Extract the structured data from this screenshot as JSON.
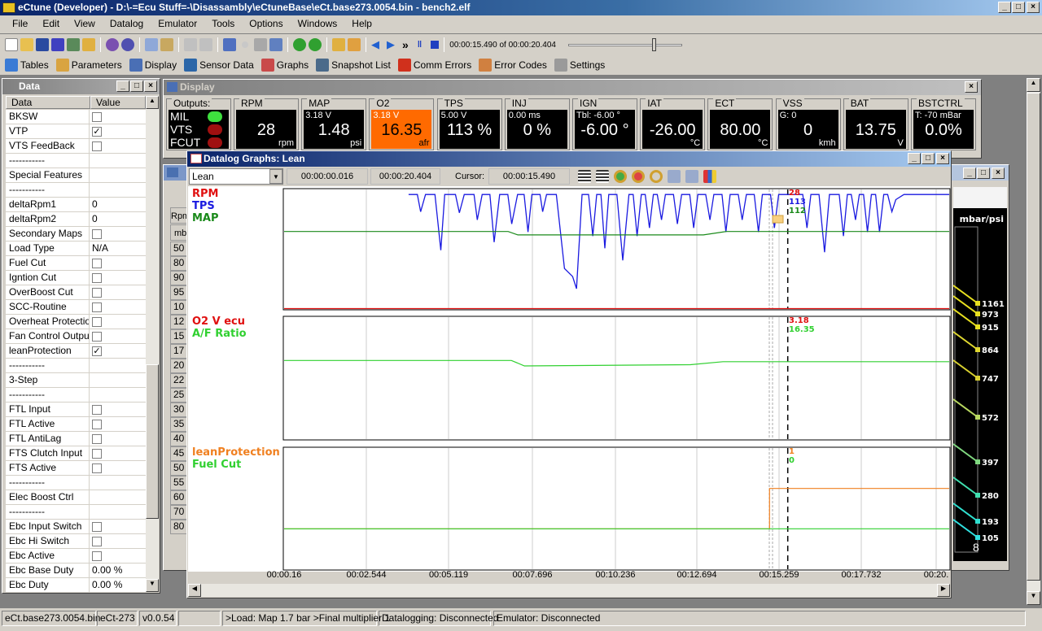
{
  "window": {
    "title": "eCtune (Developer) - D:\\-=Ecu Stuff=-\\Disassambly\\eCtuneBase\\eCt.base273.0054.bin - bench2.elf"
  },
  "menu": [
    "File",
    "Edit",
    "View",
    "Datalog",
    "Emulator",
    "Tools",
    "Options",
    "Windows",
    "Help"
  ],
  "toolbar": {
    "playback_time": "00:00:15.490 of 00:00:20.404",
    "playback_progress": 0.76
  },
  "toolbar2": [
    {
      "icon": "tables-icon",
      "label": "Tables",
      "color": "#3a7bd5"
    },
    {
      "icon": "parameters-icon",
      "label": "Parameters",
      "color": "#d9a441"
    },
    {
      "icon": "display-icon",
      "label": "Display",
      "color": "#4a6fb5"
    },
    {
      "icon": "sensor-data-icon",
      "label": "Sensor Data",
      "color": "#2b66a8"
    },
    {
      "icon": "graphs-icon",
      "label": "Graphs",
      "color": "#c94a4a"
    },
    {
      "icon": "snapshot-icon",
      "label": "Snapshot List",
      "color": "#4a6a8a"
    },
    {
      "icon": "comm-errors-icon",
      "label": "Comm Errors",
      "color": "#d0301c"
    },
    {
      "icon": "error-codes-icon",
      "label": "Error Codes",
      "color": "#d08040"
    },
    {
      "icon": "settings-icon",
      "label": "Settings",
      "color": "#9a9a9a"
    }
  ],
  "data_panel": {
    "title": "Data",
    "col_data": "Data",
    "col_value": "Value",
    "rows": [
      [
        "BKSW",
        "cb"
      ],
      [
        "VTP",
        "cbx"
      ],
      [
        "VTS FeedBack",
        "cb"
      ],
      [
        "-----------",
        ""
      ],
      [
        "Special Features",
        ""
      ],
      [
        "-----------",
        ""
      ],
      [
        "deltaRpm1",
        "0"
      ],
      [
        "deltaRpm2",
        "0"
      ],
      [
        "Secondary Maps",
        "cb"
      ],
      [
        "Load Type",
        "N/A"
      ],
      [
        "Fuel Cut",
        "cb"
      ],
      [
        "Igntion Cut",
        "cb"
      ],
      [
        "OverBoost Cut",
        "cb"
      ],
      [
        "SCC-Routine",
        "cb"
      ],
      [
        "Overheat Protection",
        "cb"
      ],
      [
        "Fan Control Output",
        "cb"
      ],
      [
        "leanProtection",
        "cbx"
      ],
      [
        "-----------",
        ""
      ],
      [
        "3-Step",
        ""
      ],
      [
        "-----------",
        ""
      ],
      [
        "FTL Input",
        "cb"
      ],
      [
        "FTL Active",
        "cb"
      ],
      [
        "FTL AntiLag",
        "cb"
      ],
      [
        "FTS Clutch Input",
        "cb"
      ],
      [
        "FTS Active",
        "cb"
      ],
      [
        "-----------",
        ""
      ],
      [
        "Elec Boost Ctrl",
        ""
      ],
      [
        "-----------",
        ""
      ],
      [
        "Ebc Input Switch",
        "cb"
      ],
      [
        "Ebc Hi Switch",
        "cb"
      ],
      [
        "Ebc Active",
        "cb"
      ],
      [
        "Ebc Base Duty",
        "0.00 %"
      ],
      [
        "Ebc Duty",
        "0.00 %"
      ]
    ]
  },
  "display": {
    "title": "Display",
    "outputs_label": "Outputs:",
    "outputs": [
      {
        "name": "MIL",
        "color": "#3ee03e"
      },
      {
        "name": "VTS",
        "color": "#a01010"
      },
      {
        "name": "FCUT",
        "color": "#a01010"
      }
    ],
    "gauges": [
      {
        "label": "RPM",
        "sub": "",
        "value": "28",
        "unit": "rpm"
      },
      {
        "label": "MAP",
        "sub": "3.18 V",
        "value": "1.48",
        "unit": "psi"
      },
      {
        "label": "O2",
        "sub": "3.18 V",
        "value": "16.35",
        "unit": "afr",
        "bg": "#ff6a00"
      },
      {
        "label": "TPS",
        "sub": "5.00 V",
        "value": "113 %",
        "unit": ""
      },
      {
        "label": "INJ",
        "sub": "0.00 ms",
        "value": "0 %",
        "unit": ""
      },
      {
        "label": "IGN",
        "sub": "Tbl: -6.00 °",
        "value": "-6.00 °",
        "unit": ""
      },
      {
        "label": "IAT",
        "sub": "",
        "value": "-26.00",
        "unit": "°C"
      },
      {
        "label": "ECT",
        "sub": "",
        "value": "80.00",
        "unit": "°C"
      },
      {
        "label": "VSS",
        "sub": "G: 0",
        "value": "0",
        "unit": "kmh"
      },
      {
        "label": "BAT",
        "sub": "",
        "value": "13.75",
        "unit": "V"
      },
      {
        "label": "BSTCTRL",
        "sub": "T: -70 mBar",
        "value": "0.0%",
        "unit": ""
      }
    ]
  },
  "tables_window": {
    "col_header": "Rpm",
    "unit_header": "mb",
    "rows": [
      "50",
      "80",
      "90",
      "95",
      "10",
      "12",
      "15",
      "17",
      "20",
      "22",
      "25",
      "30",
      "35",
      "40",
      "45",
      "50",
      "55",
      "60",
      "70",
      "80"
    ],
    "gauge_unit": "mbar/psi",
    "gauge_values": [
      "1161",
      "973",
      "915",
      "864",
      "747",
      "572",
      "397",
      "280",
      "193",
      "105"
    ],
    "gauge_bottom": "8"
  },
  "graphs": {
    "title": "Datalog Graphs: Lean",
    "preset": "Lean",
    "start": "00:00:00.016",
    "end": "00:00:20.404",
    "cursor_label": "Cursor:",
    "cursor": "00:00:15.490",
    "time_ticks": [
      "00:00.16",
      "00:02.544",
      "00:05.119",
      "00:07.696",
      "00:10.236",
      "00:12.694",
      "00:15.259",
      "00:17.732",
      "00:20."
    ],
    "xlim": [
      0.016,
      20.45
    ],
    "cursor_t": 15.49,
    "panels": [
      {
        "series": [
          {
            "name": "RPM",
            "color": "#e01010",
            "ylim": [
              0,
              9000
            ],
            "marker": "28",
            "points": [
              [
                0.016,
                28
              ],
              [
                20.45,
                28
              ]
            ]
          },
          {
            "name": "TPS",
            "color": "#1a1ae0",
            "ylim": [
              0,
              118
            ],
            "marker": "113",
            "points": [
              [
                3.84,
                113
              ],
              [
                4.11,
                113
              ],
              [
                4.21,
                96
              ],
              [
                4.36,
                113
              ],
              [
                4.65,
                113
              ],
              [
                4.83,
                58
              ],
              [
                4.95,
                113
              ],
              [
                5.28,
                113
              ],
              [
                5.4,
                95
              ],
              [
                5.55,
                113
              ],
              [
                5.85,
                113
              ],
              [
                5.95,
                88
              ],
              [
                6.1,
                113
              ],
              [
                6.34,
                113
              ],
              [
                6.47,
                66
              ],
              [
                6.64,
                113
              ],
              [
                6.89,
                113
              ],
              [
                7.01,
                84
              ],
              [
                7.19,
                113
              ],
              [
                7.39,
                113
              ],
              [
                7.51,
                76
              ],
              [
                7.63,
                113
              ],
              [
                7.88,
                113
              ],
              [
                7.96,
                96
              ],
              [
                8.08,
                113
              ],
              [
                8.38,
                113
              ],
              [
                8.63,
                40
              ],
              [
                8.88,
                32
              ],
              [
                9.0,
                20
              ],
              [
                9.17,
                113
              ],
              [
                9.37,
                113
              ],
              [
                9.5,
                72
              ],
              [
                9.62,
                113
              ],
              [
                9.75,
                113
              ],
              [
                9.87,
                60
              ],
              [
                9.99,
                113
              ],
              [
                10.24,
                113
              ],
              [
                10.42,
                48
              ],
              [
                10.61,
                113
              ],
              [
                10.74,
                113
              ],
              [
                10.86,
                72
              ],
              [
                10.99,
                113
              ],
              [
                11.11,
                113
              ],
              [
                11.24,
                80
              ],
              [
                11.36,
                113
              ],
              [
                11.48,
                113
              ],
              [
                11.61,
                88
              ],
              [
                11.73,
                113
              ],
              [
                11.98,
                113
              ],
              [
                12.1,
                84
              ],
              [
                12.23,
                113
              ],
              [
                12.48,
                113
              ],
              [
                12.6,
                80
              ],
              [
                12.73,
                113
              ],
              [
                12.97,
                113
              ],
              [
                13.1,
                88
              ],
              [
                13.22,
                113
              ],
              [
                13.47,
                113
              ],
              [
                13.59,
                76
              ],
              [
                13.72,
                113
              ],
              [
                13.97,
                113
              ],
              [
                14.09,
                88
              ],
              [
                14.22,
                113
              ],
              [
                14.46,
                113
              ],
              [
                14.59,
                76
              ],
              [
                14.71,
                113
              ],
              [
                14.96,
                113
              ],
              [
                15.08,
                80
              ],
              [
                15.21,
                113
              ],
              [
                15.95,
                113
              ],
              [
                16.08,
                80
              ],
              [
                16.2,
                113
              ],
              [
                16.45,
                113
              ],
              [
                16.62,
                56
              ],
              [
                16.77,
                113
              ],
              [
                17.07,
                113
              ],
              [
                17.2,
                72
              ],
              [
                17.32,
                113
              ],
              [
                17.44,
                113
              ],
              [
                17.57,
                88
              ],
              [
                17.69,
                113
              ],
              [
                17.82,
                113
              ],
              [
                17.94,
                76
              ],
              [
                18.06,
                113
              ],
              [
                18.19,
                113
              ],
              [
                18.31,
                76
              ],
              [
                18.44,
                113
              ],
              [
                18.56,
                113
              ],
              [
                18.69,
                96
              ],
              [
                18.81,
                108
              ],
              [
                19.06,
                113
              ],
              [
                20.45,
                113
              ]
            ]
          },
          {
            "name": "MAP",
            "color": "#1a8a1a",
            "ylim": [
              -50,
              200
            ],
            "marker": "112",
            "points": [
              [
                0.016,
                112
              ],
              [
                6.9,
                112
              ],
              [
                7.2,
                105
              ],
              [
                12.9,
                105
              ],
              [
                13.6,
                112
              ],
              [
                20.45,
                112
              ]
            ]
          }
        ]
      },
      {
        "series": [
          {
            "name": "O2 V ecu",
            "color": "#e01010",
            "ylim": [
              0,
              5
            ],
            "marker": "3.18",
            "points": []
          },
          {
            "name": "A/F Ratio",
            "color": "#30d030",
            "ylim": [
              10,
              20
            ],
            "marker": "16.35",
            "points": [
              [
                0.016,
                16.45
              ],
              [
                7.0,
                16.45
              ],
              [
                7.4,
                16.0
              ],
              [
                12.5,
                16.1
              ],
              [
                13.5,
                16.35
              ],
              [
                20.45,
                16.35
              ]
            ]
          }
        ]
      },
      {
        "series": [
          {
            "name": "leanProtection",
            "color": "#f08020",
            "ylim": [
              -1,
              2
            ],
            "marker": "1",
            "points": [
              [
                0.016,
                0
              ],
              [
                14.93,
                0
              ],
              [
                14.93,
                1
              ],
              [
                20.45,
                1
              ]
            ]
          },
          {
            "name": "Fuel Cut",
            "color": "#30d030",
            "ylim": [
              -1,
              2
            ],
            "marker": "0",
            "points": [
              [
                0.016,
                0
              ],
              [
                20.45,
                0
              ]
            ]
          }
        ]
      }
    ]
  },
  "statusbar": [
    "eCt.base273.0054.bin",
    "eCt-273",
    "v0.0.54",
    "",
    ">Load: Map 1.7 bar >Final multiplier 1",
    "Datalogging: Disconnected",
    "Emulator: Disconnected"
  ]
}
